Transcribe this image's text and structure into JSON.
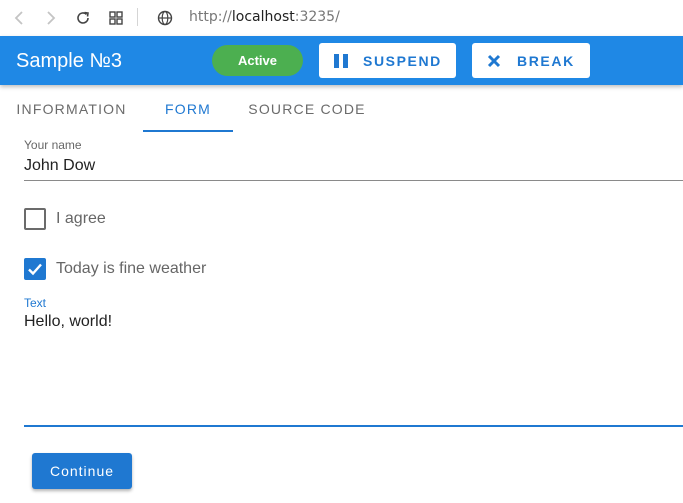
{
  "browser": {
    "url_prefix": "http://",
    "url_host": "localhost",
    "url_suffix": ":3235/",
    "icons": [
      "back-arrow-icon",
      "forward-arrow-icon",
      "reload-icon",
      "apps-grid-icon",
      "globe-icon"
    ]
  },
  "appbar": {
    "title": "Sample №3",
    "status": "Active",
    "suspend_label": "SUSPEND",
    "break_label": "BREAK",
    "colors": {
      "bar": "#1f88e5",
      "status": "#4caf50",
      "button_text": "#1f78d1"
    }
  },
  "tabs": [
    {
      "label": "INFORMATION",
      "active": false
    },
    {
      "label": "FORM",
      "active": true
    },
    {
      "label": "SOURCE CODE",
      "active": false
    }
  ],
  "form": {
    "name_label": "Your name",
    "name_value": "John Dow",
    "agree_label": "I agree",
    "agree_checked": false,
    "weather_label": "Today is fine weather",
    "weather_checked": true,
    "text_label": "Text",
    "text_value": "Hello, world!",
    "continue_label": "Continue"
  }
}
